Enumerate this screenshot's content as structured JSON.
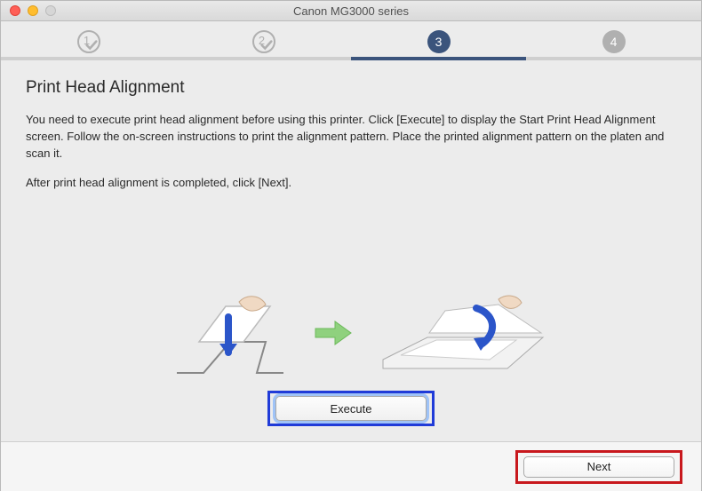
{
  "window": {
    "title": "Canon MG3000 series"
  },
  "steps": [
    {
      "n": "1",
      "state": "done"
    },
    {
      "n": "2",
      "state": "done"
    },
    {
      "n": "3",
      "state": "active"
    },
    {
      "n": "4",
      "state": "pending"
    }
  ],
  "heading": "Print Head Alignment",
  "body1": "You need to execute print head alignment before using this printer. Click [Execute] to display the Start Print Head Alignment screen. Follow the on-screen instructions to print the alignment pattern. Place the printed alignment pattern on the platen and scan it.",
  "body2": "After print head alignment is completed, click [Next].",
  "buttons": {
    "execute": "Execute",
    "next": "Next"
  }
}
